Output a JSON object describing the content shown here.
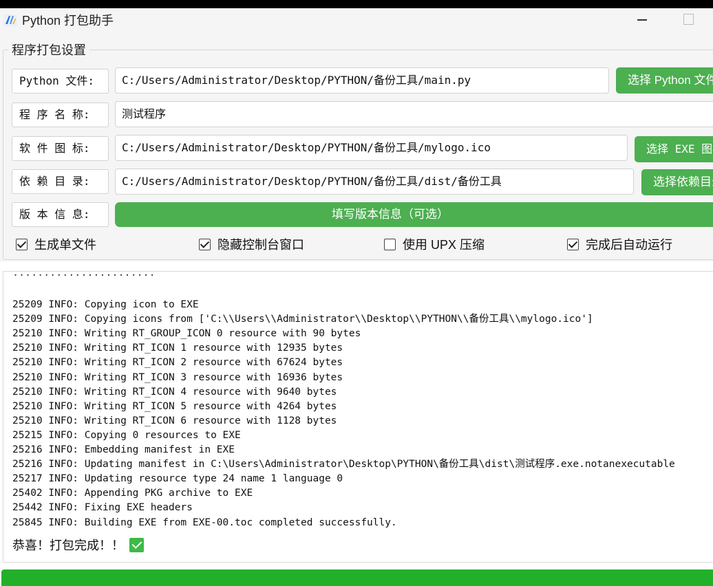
{
  "window": {
    "title": "Python 打包助手",
    "icon": "app-logo-icon",
    "controls": [
      "minimize-icon",
      "maximize-icon"
    ]
  },
  "settings": {
    "group_title": "程序打包设置",
    "python_file": {
      "label": "Python 文件:",
      "value": "C:/Users/Administrator/Desktop/PYTHON/备份工具/main.py",
      "button": "选择 Python 文件"
    },
    "program_name": {
      "label": "程 序 名 称:",
      "value": "测试程序"
    },
    "icon_file": {
      "label": "软 件 图 标:",
      "value": "C:/Users/Administrator/Desktop/PYTHON/备份工具/mylogo.ico",
      "button": "选择 EXE 图标"
    },
    "dependency_dir": {
      "label": "依 赖 目 录:",
      "value": "C:/Users/Administrator/Desktop/PYTHON/备份工具/dist/备份工具",
      "button": "选择依赖目录"
    },
    "version_info": {
      "label": "版 本 信 息:",
      "button": "填写版本信息（可选）"
    },
    "options": [
      {
        "label": "生成单文件",
        "checked": true
      },
      {
        "label": "隐藏控制台窗口",
        "checked": true
      },
      {
        "label": "使用 UPX 压缩",
        "checked": false
      },
      {
        "label": "完成后自动运行",
        "checked": true
      }
    ]
  },
  "log": {
    "lines": [
      "25209 INFO: Copying icon to EXE",
      "25209 INFO: Copying icons from ['C:\\\\Users\\\\Administrator\\\\Desktop\\\\PYTHON\\\\备份工具\\\\mylogo.ico']",
      "25210 INFO: Writing RT_GROUP_ICON 0 resource with 90 bytes",
      "25210 INFO: Writing RT_ICON 1 resource with 12935 bytes",
      "25210 INFO: Writing RT_ICON 2 resource with 67624 bytes",
      "25210 INFO: Writing RT_ICON 3 resource with 16936 bytes",
      "25210 INFO: Writing RT_ICON 4 resource with 9640 bytes",
      "25210 INFO: Writing RT_ICON 5 resource with 4264 bytes",
      "25210 INFO: Writing RT_ICON 6 resource with 1128 bytes",
      "25215 INFO: Copying 0 resources to EXE",
      "25216 INFO: Embedding manifest in EXE",
      "25216 INFO: Updating manifest in C:\\Users\\Administrator\\Desktop\\PYTHON\\备份工具\\dist\\测试程序.exe.notanexecutable",
      "25217 INFO: Updating resource type 24 name 1 language 0",
      "25402 INFO: Appending PKG archive to EXE",
      "25442 INFO: Fixing EXE headers",
      "25845 INFO: Building EXE from EXE-00.toc completed successfully."
    ],
    "success_message": "恭喜！打包完成！！",
    "success_icon": "check-mark-icon"
  },
  "colors": {
    "accent": "#4caf50",
    "progress": "#22b02a"
  }
}
